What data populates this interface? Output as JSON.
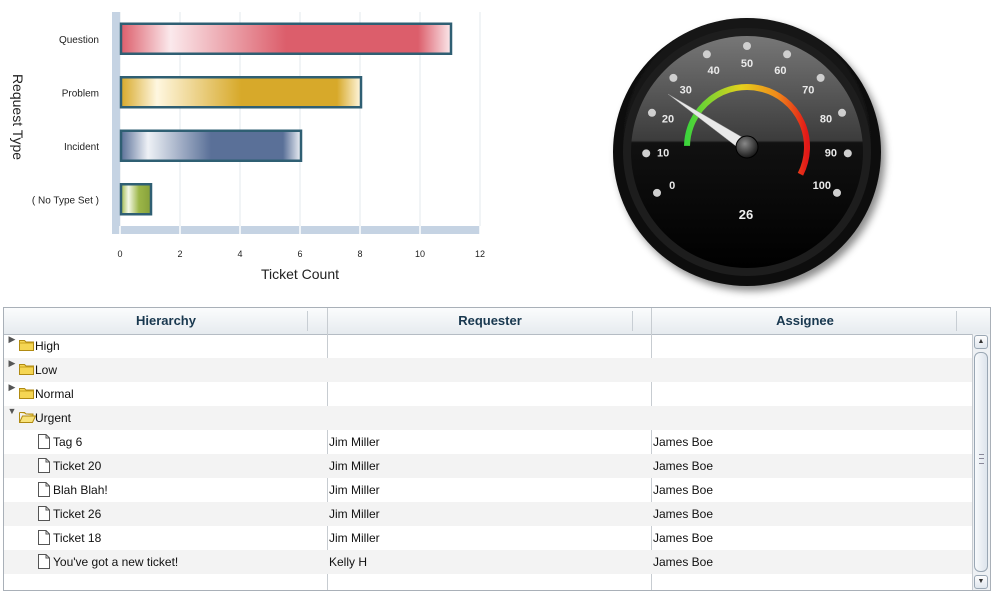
{
  "chart_data": {
    "type": "bar",
    "orientation": "horizontal",
    "categories": [
      "Question",
      "Problem",
      "Incident",
      "( No Type Set )"
    ],
    "values": [
      11,
      8,
      6,
      1
    ],
    "colors": [
      "#dc5e6b",
      "#d7a92a",
      "#5a7098",
      "#9cb648"
    ],
    "xlabel": "Ticket Count",
    "ylabel": "Request Type",
    "xlim": [
      0,
      12
    ],
    "xticks": [
      "0",
      "2",
      "4",
      "6",
      "8",
      "10",
      "12"
    ],
    "grid": true
  },
  "gauge": {
    "value": 26,
    "value_label": "26",
    "min": 0,
    "max": 100,
    "tick_labels": [
      "0",
      "10",
      "20",
      "30",
      "40",
      "50",
      "60",
      "70",
      "80",
      "90",
      "100"
    ]
  },
  "grid": {
    "columns": [
      "Hierarchy",
      "Requester",
      "Assignee"
    ],
    "rows": [
      {
        "name": "High",
        "requester": "",
        "assignee": "",
        "type": "folder",
        "expanded": false
      },
      {
        "name": "Low",
        "requester": "",
        "assignee": "",
        "type": "folder",
        "expanded": false
      },
      {
        "name": "Normal",
        "requester": "",
        "assignee": "",
        "type": "folder",
        "expanded": false
      },
      {
        "name": "Urgent",
        "requester": "",
        "assignee": "",
        "type": "folder",
        "expanded": true
      },
      {
        "name": "Tag 6",
        "requester": "Jim Miller",
        "assignee": "James Boe",
        "type": "file"
      },
      {
        "name": "Ticket 20",
        "requester": "Jim Miller",
        "assignee": "James Boe",
        "type": "file"
      },
      {
        "name": "Blah Blah!",
        "requester": "Jim Miller",
        "assignee": "James Boe",
        "type": "file"
      },
      {
        "name": "Ticket 26",
        "requester": "Jim Miller",
        "assignee": "James Boe",
        "type": "file"
      },
      {
        "name": "Ticket 18",
        "requester": "Jim Miller",
        "assignee": "James Boe",
        "type": "file"
      },
      {
        "name": "You've got a new ticket!",
        "requester": "Kelly H",
        "assignee": "James Boe",
        "type": "file"
      }
    ]
  }
}
